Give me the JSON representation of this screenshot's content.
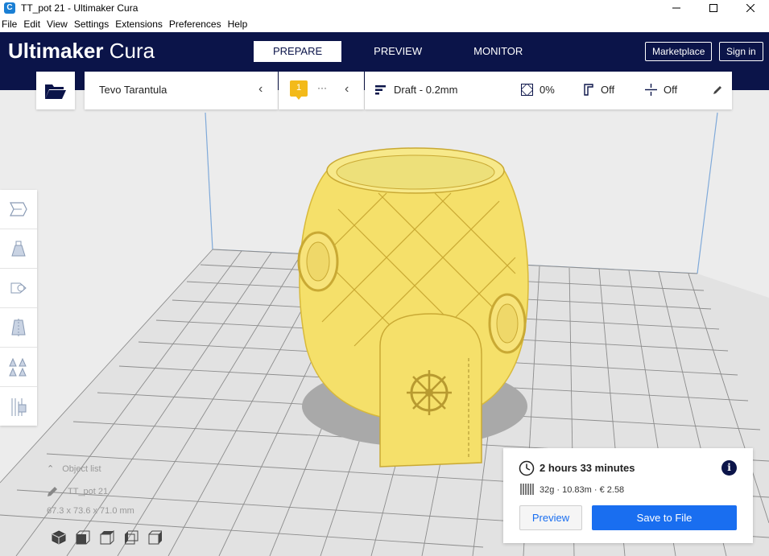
{
  "window": {
    "title": "TT_pot 21 - Ultimaker Cura",
    "controls": [
      "minimize",
      "maximize",
      "close"
    ]
  },
  "menu": {
    "items": [
      "File",
      "Edit",
      "View",
      "Settings",
      "Extensions",
      "Preferences",
      "Help"
    ]
  },
  "header": {
    "logo_bold": "Ultimaker",
    "logo_light": "Cura",
    "tabs": [
      {
        "label": "PREPARE",
        "active": true
      },
      {
        "label": "PREVIEW",
        "active": false
      },
      {
        "label": "MONITOR",
        "active": false
      }
    ],
    "marketplace_label": "Marketplace",
    "signin_label": "Sign in",
    "background_color": "#0b1449"
  },
  "toolbar": {
    "open_icon": "folder-open-icon",
    "printer_name": "Tevo Tarantula",
    "extruder_number": "1",
    "extruder_dots": "···",
    "profile": "Draft - 0.2mm",
    "infill": "0%",
    "support": "Off",
    "adhesion": "Off"
  },
  "left_tools": [
    {
      "icon": "move-icon"
    },
    {
      "icon": "scale-icon"
    },
    {
      "icon": "rotate-icon"
    },
    {
      "icon": "mirror-icon"
    },
    {
      "icon": "per-model-settings-icon"
    },
    {
      "icon": "support-blocker-icon"
    }
  ],
  "object_list": {
    "header": "Object list",
    "object_name": "TT_pot 21",
    "dimensions": "67.3 x 73.6 x 71.0 mm"
  },
  "view_buttons": [
    "3d-view-icon",
    "front-view-icon",
    "top-view-icon",
    "left-view-icon",
    "right-view-icon"
  ],
  "print_info": {
    "time": "2 hours 33 minutes",
    "material": "32g · 10.83m · € 2.58",
    "preview_label": "Preview",
    "save_label": "Save to File",
    "accent_color": "#196ef0"
  },
  "model": {
    "color": "#f5e06a"
  }
}
